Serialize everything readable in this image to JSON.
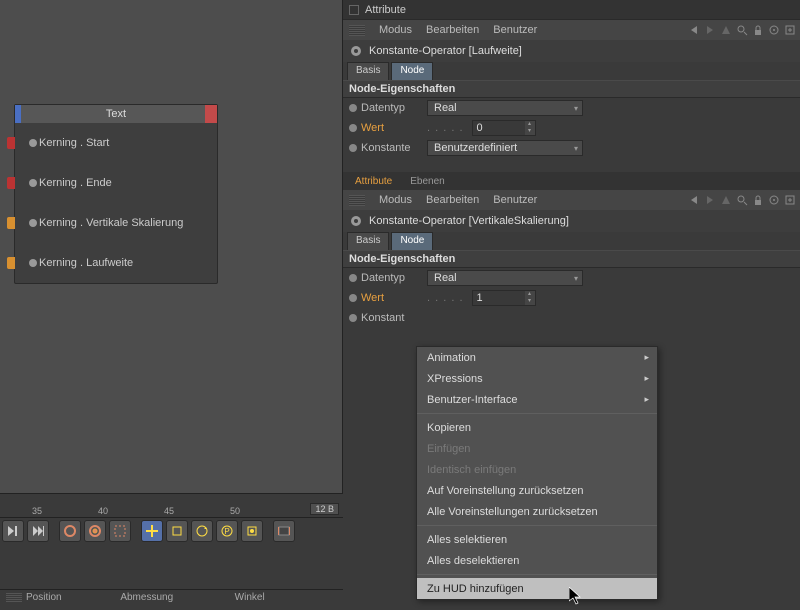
{
  "viewport": {
    "node": {
      "title": "Text",
      "ports": [
        "Kerning . Start",
        "Kerning . Ende",
        "Kerning . Vertikale Skalierung",
        "Kerning . Laufweite"
      ]
    }
  },
  "panel1": {
    "title": "Attribute",
    "menu": [
      "Modus",
      "Bearbeiten",
      "Benutzer"
    ],
    "object": "Konstante-Operator [Laufweite]",
    "tabs": [
      "Basis",
      "Node"
    ],
    "section": "Node-Eigenschaften",
    "props": {
      "datentyp_lbl": "Datentyp",
      "datentyp_val": "Real",
      "wert_lbl": "Wert",
      "wert_val": "0",
      "konst_lbl": "Konstante",
      "konst_val": "Benutzerdefiniert"
    }
  },
  "panel2": {
    "tabs_top": [
      "Attribute",
      "Ebenen"
    ],
    "menu": [
      "Modus",
      "Bearbeiten",
      "Benutzer"
    ],
    "object": "Konstante-Operator [VertikaleSkalierung]",
    "tabs": [
      "Basis",
      "Node"
    ],
    "section": "Node-Eigenschaften",
    "props": {
      "datentyp_lbl": "Datentyp",
      "datentyp_val": "Real",
      "wert_lbl": "Wert",
      "wert_val": "1",
      "konst_lbl": "Konstant"
    }
  },
  "ctx": {
    "items": [
      {
        "label": "Animation",
        "sub": true
      },
      {
        "label": "XPressions",
        "sub": true
      },
      {
        "label": "Benutzer-Interface",
        "sub": true
      },
      "sep",
      {
        "label": "Kopieren"
      },
      {
        "label": "Einfügen",
        "disabled": true
      },
      {
        "label": "Identisch einfügen",
        "disabled": true
      },
      {
        "label": "Auf Voreinstellung zurücksetzen"
      },
      {
        "label": "Alle Voreinstellungen zurücksetzen"
      },
      "sep",
      {
        "label": "Alles selektieren"
      },
      {
        "label": "Alles deselektieren"
      },
      "sep",
      {
        "label": "Zu HUD hinzufügen",
        "hover": true
      }
    ]
  },
  "timeline": {
    "ticks": [
      "35",
      "40",
      "45",
      "50"
    ],
    "end": "12 B"
  },
  "footer": [
    "Position",
    "Abmessung",
    "Winkel"
  ]
}
